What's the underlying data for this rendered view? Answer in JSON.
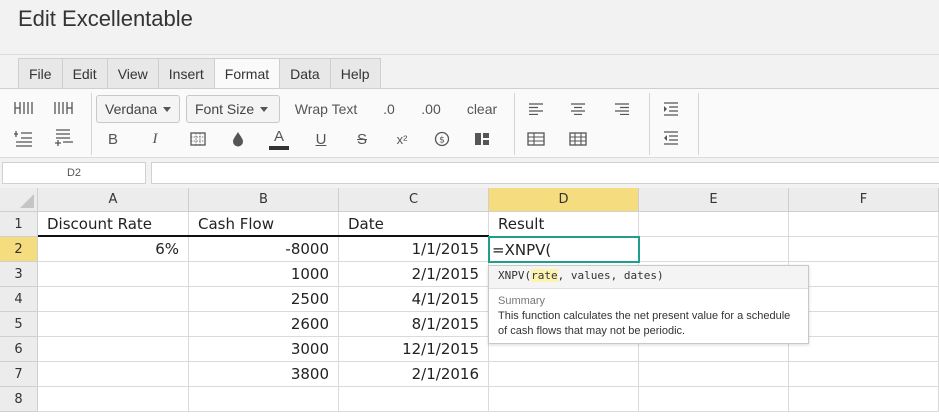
{
  "app": {
    "title": "Edit Excellentable"
  },
  "menu": [
    "File",
    "Edit",
    "View",
    "Insert",
    "Format",
    "Data",
    "Help"
  ],
  "menu_active": "Format",
  "toolbar": {
    "font_family": "Verdana",
    "font_size": "Font Size",
    "wrap_text": "Wrap Text",
    "decrease_decimal": ".0",
    "increase_decimal": ".00",
    "clear": "clear",
    "bold": "B",
    "italic": "I",
    "font_color": "A",
    "underline": "U",
    "strike": "S",
    "superscript": "x²"
  },
  "name_box": "D2",
  "formula_bar": "",
  "columns": [
    "A",
    "B",
    "C",
    "D",
    "E",
    "F"
  ],
  "rows": [
    "1",
    "2",
    "3",
    "4",
    "5",
    "6",
    "7",
    "8"
  ],
  "cells": {
    "A1": "Discount Rate",
    "B1": "Cash Flow",
    "C1": "Date",
    "D1": "Result",
    "A2": "6%",
    "B2": "-8000",
    "C2": "1/1/2015",
    "D2": "=XNPV(",
    "B3": "1000",
    "C3": "2/1/2015",
    "B4": "2500",
    "C4": "4/1/2015",
    "B5": "2600",
    "C5": "8/1/2015",
    "B6": "3000",
    "C6": "12/1/2015",
    "B7": "3800",
    "C7": "2/1/2016"
  },
  "tooltip": {
    "sig_prefix": "XNPV(",
    "sig_param": "rate",
    "sig_suffix": ", values, dates)",
    "summary_label": "Summary",
    "description_line1": "This function calculates the net present value for a schedule",
    "description_line2": "of cash flows that may not be periodic."
  },
  "colors": {
    "selection_accent": "#1f9e8c",
    "header_highlight": "#f5dc7e"
  }
}
